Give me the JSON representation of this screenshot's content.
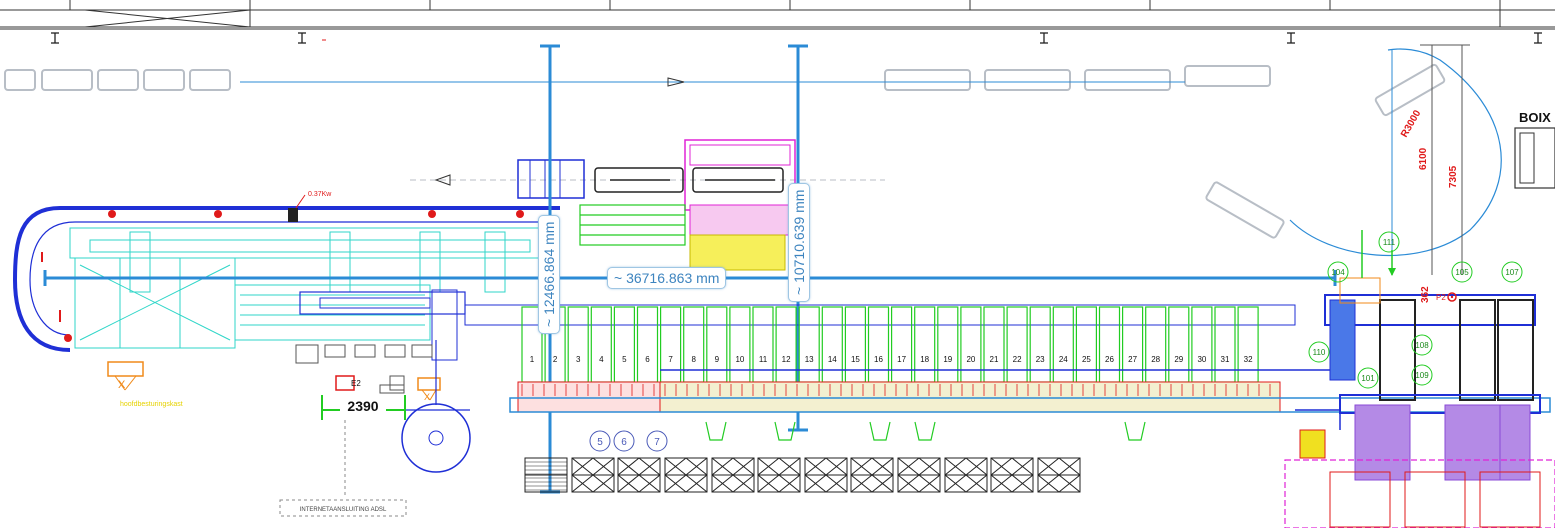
{
  "measurements": {
    "horizontal": "~ 36716.863 mm",
    "vertical_left": "~ 12466.864 mm",
    "vertical_right": "~ 10710.639 mm"
  },
  "labels": {
    "boix": "BOIX",
    "motor": "0.37Kw",
    "dimension_2390": "2390",
    "hoofd": "hoofdbesturingskast",
    "internet": "INTERNETAANSLUITING ADSL",
    "radius": "R3000",
    "dim_6100": "6100",
    "dim_7305": "7305",
    "dim_362": "362",
    "e2": "E2",
    "p2": "P2",
    "x1": "X",
    "x2": "X"
  },
  "stations": [
    "1",
    "2",
    "3",
    "4",
    "5",
    "6",
    "7",
    "8",
    "9",
    "10",
    "11",
    "12",
    "13",
    "14",
    "15",
    "16",
    "17",
    "18",
    "19",
    "20",
    "21",
    "22",
    "23",
    "24",
    "25",
    "26",
    "27",
    "28",
    "29",
    "30",
    "31",
    "32"
  ],
  "circles_bottom": [
    "5",
    "6",
    "7"
  ],
  "circles_right": [
    "104",
    "105",
    "107",
    "108",
    "109",
    "110",
    "101",
    "111"
  ],
  "colors": {
    "blue": "#1f2fd6",
    "measure": "#2b8bd6",
    "green": "#22cc22",
    "cyan": "#2fd6c8",
    "magenta": "#e023d6",
    "red": "#e01a1a",
    "yellow": "#f0e020",
    "orange": "#f08a1a",
    "gray": "#b8bec6",
    "purple": "#8a4ad6"
  }
}
